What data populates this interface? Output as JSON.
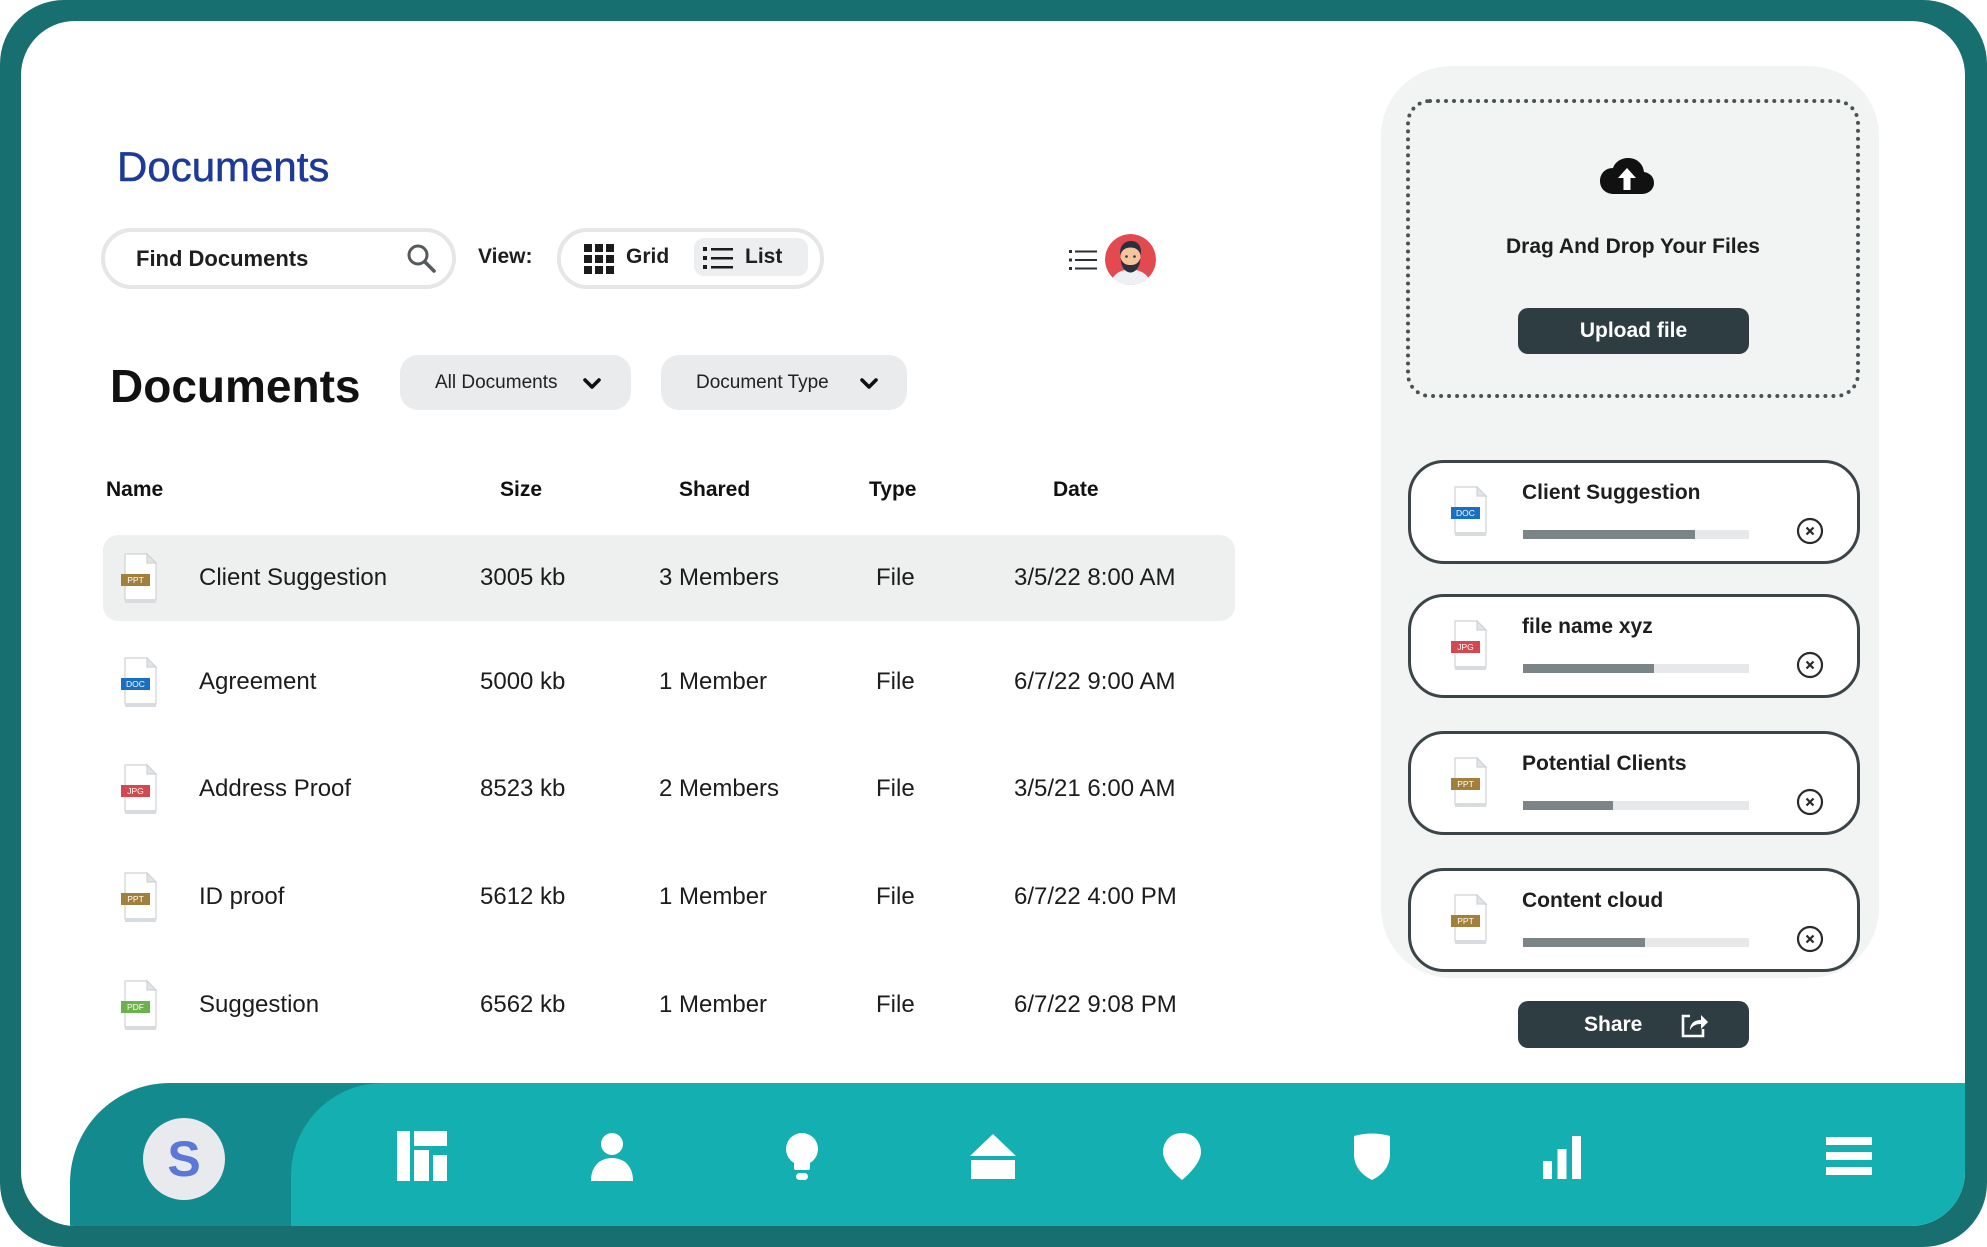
{
  "page": {
    "title": "Documents"
  },
  "search": {
    "placeholder": "Find Documents",
    "icon": "search-icon"
  },
  "view": {
    "label": "View:",
    "options": [
      {
        "label": "Grid",
        "icon": "grid-icon",
        "selected": false
      },
      {
        "label": "List",
        "icon": "list-icon",
        "selected": true
      }
    ]
  },
  "header_tools": {
    "menu_icon": "list-menu-icon",
    "avatar": "user-avatar"
  },
  "documents": {
    "heading": "Documents",
    "filters": [
      {
        "label": "All Documents",
        "icon": "chevron-down-icon"
      },
      {
        "label": "Document Type",
        "icon": "chevron-down-icon"
      }
    ],
    "columns": [
      "Name",
      "Size",
      "Shared",
      "Type",
      "Date"
    ],
    "rows": [
      {
        "icon": "ppt-file-icon",
        "icon_label": "PPT",
        "icon_color": "#a2803c",
        "name": "Client Suggestion",
        "size": "3005 kb",
        "shared": "3 Members",
        "type": "File",
        "date": "3/5/22 8:00 AM",
        "highlighted": true
      },
      {
        "icon": "doc-file-icon",
        "icon_label": "DOC",
        "icon_color": "#1a6fc4",
        "name": "Agreement",
        "size": "5000 kb",
        "shared": "1 Member",
        "type": "File",
        "date": "6/7/22 9:00 AM",
        "highlighted": false
      },
      {
        "icon": "jpg-file-icon",
        "icon_label": "JPG",
        "icon_color": "#d2494f",
        "name": "Address Proof",
        "size": "8523 kb",
        "shared": "2 Members",
        "type": "File",
        "date": "3/5/21 6:00 AM",
        "highlighted": false
      },
      {
        "icon": "ppt-file-icon",
        "icon_label": "PPT",
        "icon_color": "#a2803c",
        "name": "ID proof",
        "size": "5612 kb",
        "shared": "1 Member",
        "type": "File",
        "date": "6/7/22 4:00 PM",
        "highlighted": false
      },
      {
        "icon": "pdf-file-icon",
        "icon_label": "PDF",
        "icon_color": "#6cb24a",
        "name": "Suggestion",
        "size": "6562 kb",
        "shared": "1 Member",
        "type": "File",
        "date": "6/7/22 9:08 PM",
        "highlighted": false
      }
    ]
  },
  "upload": {
    "icon": "cloud-upload-icon",
    "prompt": "Drag And Drop Your Files",
    "button": "Upload file"
  },
  "uploads": [
    {
      "icon": "doc-file-icon",
      "icon_label": "DOC",
      "icon_color": "#1a6fc4",
      "name": "Client Suggestion",
      "progress": 0.76
    },
    {
      "icon": "jpg-file-icon",
      "icon_label": "JPG",
      "icon_color": "#d2494f",
      "name": "file name xyz",
      "progress": 0.58
    },
    {
      "icon": "ppt-file-icon",
      "icon_label": "PPT",
      "icon_color": "#a2803c",
      "name": "Potential Clients",
      "progress": 0.4
    },
    {
      "icon": "ppt-file-icon",
      "icon_label": "PPT",
      "icon_color": "#a2803c",
      "name": "Content cloud",
      "progress": 0.54
    }
  ],
  "share": {
    "label": "Share",
    "icon": "share-icon"
  },
  "nav": {
    "brand_letter": "S",
    "items": [
      {
        "icon": "dashboard-icon"
      },
      {
        "icon": "user-icon"
      },
      {
        "icon": "lightbulb-icon"
      },
      {
        "icon": "home-icon"
      },
      {
        "icon": "location-pin-icon"
      },
      {
        "icon": "shield-icon"
      },
      {
        "icon": "bar-chart-icon"
      },
      {
        "icon": "menu-icon"
      }
    ]
  },
  "colors": {
    "frame": "#186f70",
    "nav_dark": "#138a8e",
    "nav_light": "#13afb1",
    "title_blue": "#1d3a98",
    "button_dark": "#2e3d42",
    "brand_letter": "#5a78d8"
  }
}
